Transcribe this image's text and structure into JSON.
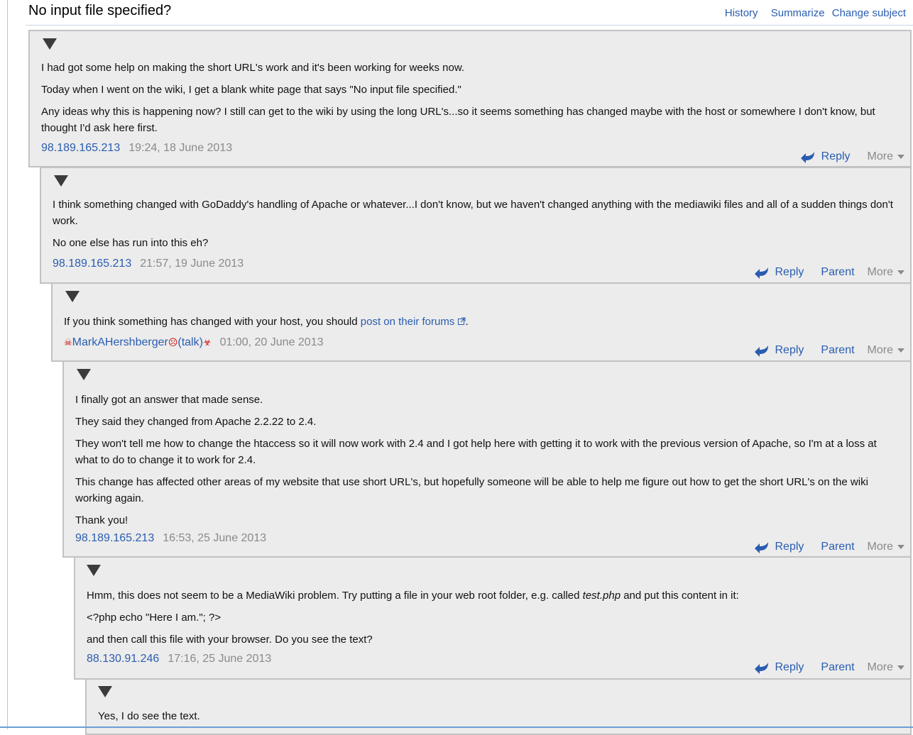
{
  "topic": {
    "title": "No input file specified?",
    "actions": {
      "history": "History",
      "summarize": "Summarize",
      "change_subject": "Change subject"
    }
  },
  "labels": {
    "reply": "Reply",
    "parent": "Parent",
    "more": "More"
  },
  "posts": [
    {
      "paragraphs": [
        "I had got some help on making the short URL's work and it's been working for weeks now.",
        "Today when I went on the wiki, I get a blank white page that says \"No input file specified.\"",
        "Any ideas why this is happening now? I still can get to the wiki by using the long URL's...so it seems something has changed maybe with the host or somewhere I don't know, but thought I'd ask here first."
      ],
      "author": "98.189.165.213",
      "timestamp": "19:24, 18 June 2013"
    },
    {
      "paragraphs": [
        "I think something changed with GoDaddy's handling of Apache or whatever...I don't know, but we haven't changed anything with the mediawiki files and all of a sudden things don't work.",
        "No one else has run into this eh?"
      ],
      "author": "98.189.165.213",
      "timestamp": "21:57, 19 June 2013"
    },
    {
      "text_before_link": "If you think something has changed with your host, you should ",
      "link_text": "post on their forums",
      "text_after_link": ".",
      "author_name": "MarkAHershberger",
      "author_talk": "(talk)",
      "timestamp": "01:00, 20 June 2013"
    },
    {
      "paragraphs": [
        "I finally got an answer that made sense.",
        "They said they changed from Apache 2.2.22 to 2.4.",
        "They won't tell me how to change the htaccess so it will now work with 2.4 and I got help here with getting it to work with the previous version of Apache, so I'm at a loss at what to do to change it to work for 2.4.",
        "This change has affected other areas of my website that use short URL's, but hopefully someone will be able to help me figure out how to get the short URL's on the wiki working again.",
        "Thank you!"
      ],
      "author": "98.189.165.213",
      "timestamp": "16:53, 25 June 2013"
    },
    {
      "p1_before": "Hmm, this does not seem to be a MediaWiki problem. Try putting a file in your web root folder, e.g. called ",
      "p1_em": "test.php",
      "p1_after": " and put this content in it:",
      "p2": "<?php echo \"Here I am.\"; ?>",
      "p3": "and then call this file with your browser. Do you see the text?",
      "author": "88.130.91.246",
      "timestamp": "17:16, 25 June 2013"
    },
    {
      "paragraphs": [
        "Yes, I do see the text."
      ]
    }
  ],
  "icons": {
    "toggle": "collapse-triangle-icon",
    "reply": "reply-arrow-icon",
    "external": "external-link-icon"
  }
}
